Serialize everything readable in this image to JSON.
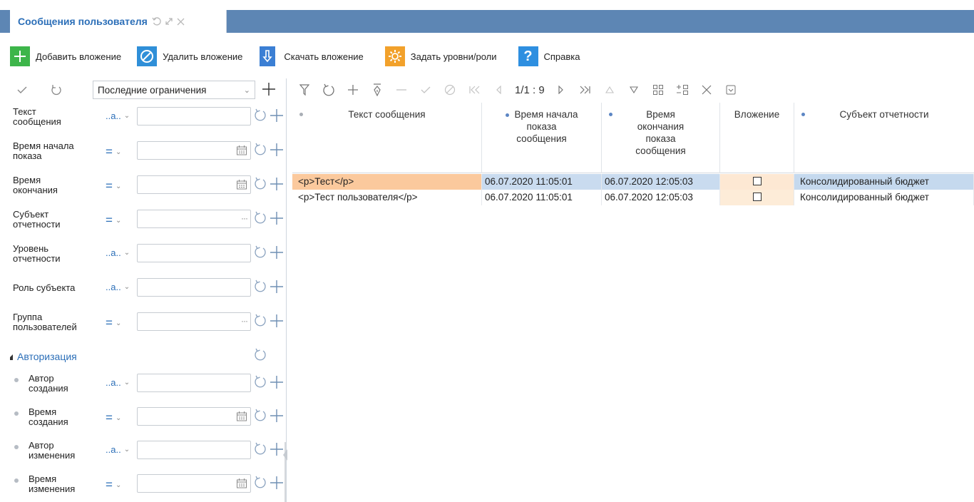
{
  "window": {
    "tab_title": "Сообщения пользователя"
  },
  "toolbar": {
    "add_attachment": "Добавить вложение",
    "delete_attachment": "Удалить вложение",
    "download_attachment": "Скачать вложение",
    "set_levels_roles": "Задать уровни/роли",
    "help": "Справка"
  },
  "filter_panel": {
    "preset": "Последние ограничения",
    "filters": [
      {
        "label_1": "Текст",
        "label_2": "сообщения",
        "operator": "..a..",
        "input_icon": ""
      },
      {
        "label_1": "Время начала",
        "label_2": "показа",
        "operator": "=",
        "input_icon": "calendar-icon"
      },
      {
        "label_1": "Время",
        "label_2": "окончания",
        "operator": "=",
        "input_icon": "calendar-icon"
      },
      {
        "label_1": "Субъект",
        "label_2": "отчетности",
        "operator": "=",
        "input_icon": "ellipsis-icon"
      },
      {
        "label_1": "Уровень",
        "label_2": "отчетности",
        "operator": "..a..",
        "input_icon": ""
      },
      {
        "label_1": "Роль субъекта",
        "label_2": "",
        "operator": "..a..",
        "input_icon": ""
      },
      {
        "label_1": "Группа",
        "label_2": "пользователей",
        "operator": "=",
        "input_icon": "ellipsis-icon"
      }
    ],
    "section_title": "Авторизация",
    "auth_filters": [
      {
        "label_1": "Автор",
        "label_2": "создания",
        "operator": "..a..",
        "input_icon": ""
      },
      {
        "label_1": "Время",
        "label_2": "создания",
        "operator": "=",
        "input_icon": "calendar-icon"
      },
      {
        "label_1": "Автор",
        "label_2": "изменения",
        "operator": "..a..",
        "input_icon": ""
      },
      {
        "label_1": "Время",
        "label_2": "изменения",
        "operator": "=",
        "input_icon": "calendar-icon"
      }
    ]
  },
  "grid": {
    "pager": "1/1 : 9",
    "columns": [
      {
        "line_1": "Текст сообщения",
        "line_2": "",
        "line_3": ""
      },
      {
        "line_1": "Время начала",
        "line_2": "показа",
        "line_3": "сообщения"
      },
      {
        "line_1": "Время",
        "line_2": "окончания",
        "line_3": "показа",
        "line_4": "сообщения"
      },
      {
        "line_1": "Вложение",
        "line_2": "",
        "line_3": ""
      },
      {
        "line_1": "Субъект отчетности",
        "line_2": "",
        "line_3": ""
      }
    ],
    "rows": [
      {
        "text": "<p>Тест</p>",
        "start": "06.07.2020 11:05:01",
        "end": "06.07.2020 12:05:03",
        "attachment": false,
        "subject": "Консолидированный бюджет"
      },
      {
        "text": "<p>Тест пользователя</p>",
        "start": "06.07.2020 11:05:01",
        "end": "06.07.2020 12:05:03",
        "attachment": false,
        "subject": "Консолидированный бюджет"
      }
    ]
  },
  "colors": {
    "titlebar": "#5d86b4",
    "accent_blue": "#2c6fb8",
    "add_green": "#3db54a",
    "delete_blue": "#2f8fd8",
    "download_blue": "#3b7fd4",
    "levels_orange": "#f2a12b",
    "help_blue": "#2e8fe0",
    "row_selected_orange": "#fbc99d",
    "row_selected_blue": "#c9dbef"
  }
}
